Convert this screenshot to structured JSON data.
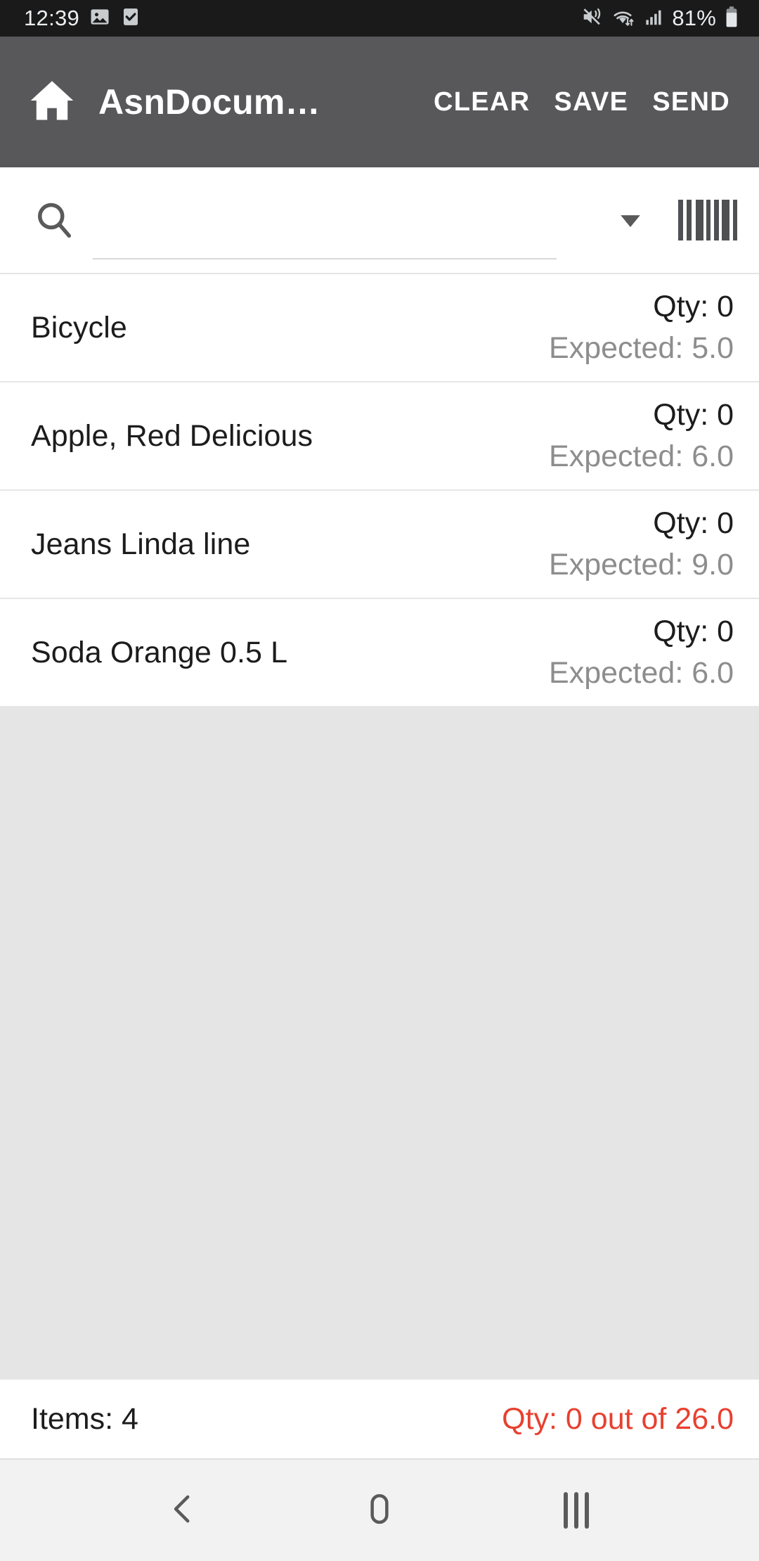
{
  "status_bar": {
    "time": "12:39",
    "battery_percent": "81%",
    "icons": [
      "photo-icon",
      "checkbox-icon",
      "vibrate-mute-icon",
      "wifi-icon",
      "cellular-signal-icon",
      "battery-icon"
    ]
  },
  "toolbar": {
    "home_label": "home-icon",
    "title": "AsnDocum…",
    "clear_label": "CLEAR",
    "save_label": "SAVE",
    "send_label": "SEND",
    "background_color": "#58585a"
  },
  "search": {
    "value": "",
    "placeholder": "",
    "search_icon": "search-icon",
    "dropdown_icon": "chevron-down-icon",
    "barcode_icon": "barcode-scan-icon"
  },
  "list": {
    "qty_prefix": "Qty: ",
    "expected_prefix": "Expected: ",
    "rows": [
      {
        "name": "Bicycle",
        "qty": "Qty: 0",
        "expected": "Expected: 5.0"
      },
      {
        "name": "Apple, Red Delicious",
        "qty": "Qty: 0",
        "expected": "Expected: 6.0"
      },
      {
        "name": "Jeans Linda line",
        "qty": "Qty: 0",
        "expected": "Expected: 9.0"
      },
      {
        "name": "Soda Orange 0.5 L",
        "qty": "Qty: 0",
        "expected": "Expected: 6.0"
      }
    ]
  },
  "summary": {
    "items": "Items: 4",
    "qty_total": "Qty: 0 out of 26.0",
    "qty_total_color": "#e8402f"
  },
  "navbar": {
    "back_label": "back-icon",
    "home_label": "home-circle-icon",
    "recents_label": "recents-icon"
  }
}
